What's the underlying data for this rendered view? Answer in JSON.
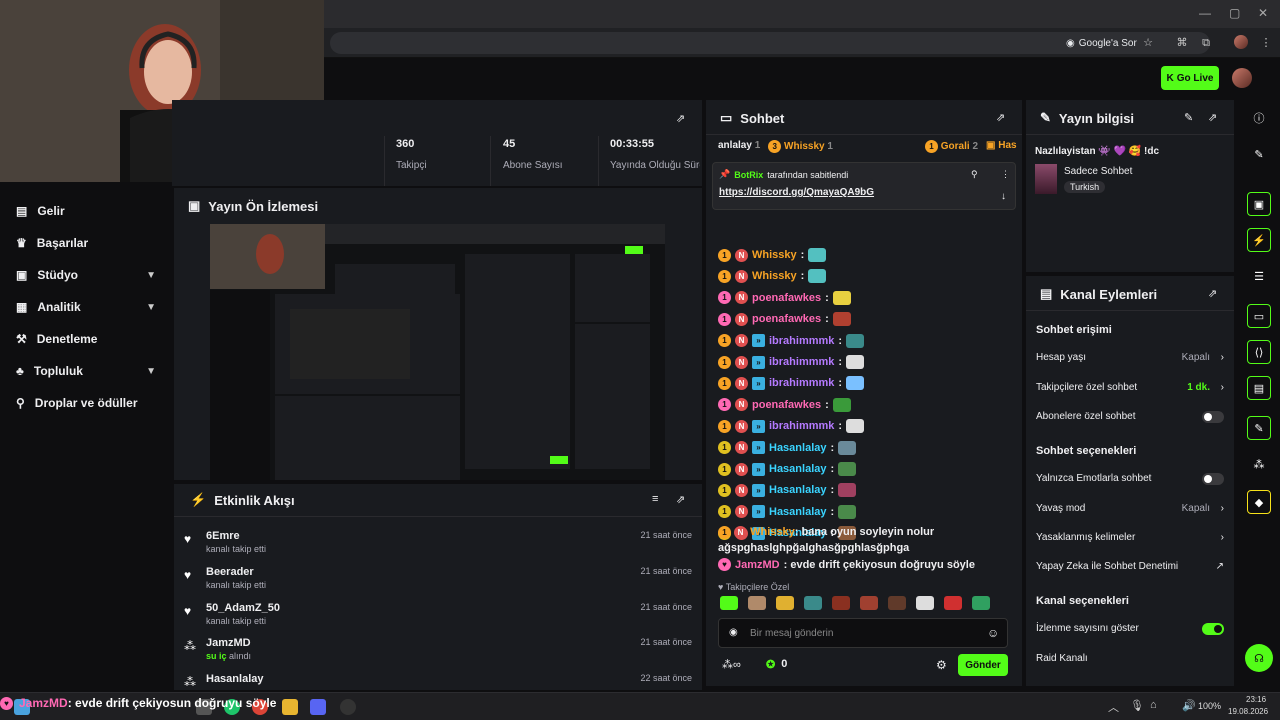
{
  "browser": {
    "google_ask": "Google'a Sor"
  },
  "topnav": {
    "go_live": "Go Live"
  },
  "sidebar": {
    "items": [
      {
        "label": "Gelir",
        "icon": "revenue-icon"
      },
      {
        "label": "Başarılar",
        "icon": "trophy-icon"
      },
      {
        "label": "Stüdyo",
        "icon": "studio-icon"
      },
      {
        "label": "Analitik",
        "icon": "analytics-icon"
      },
      {
        "label": "Denetleme",
        "icon": "moderation-icon"
      },
      {
        "label": "Topluluk",
        "icon": "community-icon"
      },
      {
        "label": "Droplar ve ödüller",
        "icon": "drops-icon"
      }
    ]
  },
  "stats": {
    "followers_value": "360",
    "followers_label": "Takipçi",
    "subs_value": "45",
    "subs_label": "Abone Sayısı",
    "uptime_value": "00:33:55",
    "uptime_label": "Yayında Olduğu Süre"
  },
  "preview": {
    "title": "Yayın Ön İzlemesi"
  },
  "events": {
    "title": "Etkinlik Akışı",
    "items": [
      {
        "name": "6Emre",
        "sub": "kanalı takip etti",
        "time": "21 saat önce",
        "icon": "heart-icon"
      },
      {
        "name": "Beerader",
        "sub": "kanalı takip etti",
        "time": "21 saat önce",
        "icon": "heart-icon"
      },
      {
        "name": "50_AdamZ_50",
        "sub": "kanalı takip etti",
        "time": "21 saat önce",
        "icon": "heart-icon"
      },
      {
        "name": "JamzMD",
        "sub_highlight": "su iç",
        "sub": "alındı",
        "time": "21 saat önce",
        "icon": "reward-icon"
      },
      {
        "name": "Hasanlalay",
        "sub": "",
        "time": "22 saat önce",
        "icon": "reward-icon"
      }
    ]
  },
  "chat": {
    "title": "Sohbet",
    "top_gifters": [
      {
        "name": "anlalay",
        "count": "1"
      },
      {
        "name": "Whissky",
        "count": "1",
        "rank": "3"
      },
      {
        "name": "Gorali",
        "count": "2",
        "rank": "1"
      },
      {
        "name": "Has"
      }
    ],
    "pinned_by": "BotRix",
    "pinned_suffix": "tarafından sabitlendi",
    "pinned_link": "https://discord.gg/QmayaQA9bG",
    "messages": [
      {
        "user": "Whissky",
        "color": "#f7a325",
        "text": ":"
      },
      {
        "user": "Whissky",
        "color": "#f7a325",
        "text": ":"
      },
      {
        "user": "poenafawkes",
        "color": "#ff69b4",
        "text": ":"
      },
      {
        "user": "poenafawkes",
        "color": "#ff69b4",
        "text": ":"
      },
      {
        "user": "ibrahimmmk",
        "color": "#b57aff",
        "text": ":"
      },
      {
        "user": "ibrahimmmk",
        "color": "#b57aff",
        "text": ":"
      },
      {
        "user": "ibrahimmmk",
        "color": "#b57aff",
        "text": ":"
      },
      {
        "user": "poenafawkes",
        "color": "#ff69b4",
        "text": ":"
      },
      {
        "user": "ibrahimmmk",
        "color": "#b57aff",
        "text": ":"
      },
      {
        "user": "Hasanlalay",
        "color": "#3ad4ff",
        "text": ":"
      },
      {
        "user": "Hasanlalay",
        "color": "#3ad4ff",
        "text": ":"
      },
      {
        "user": "Hasanlalay",
        "color": "#3ad4ff",
        "text": ":"
      },
      {
        "user": "Hasanlalay",
        "color": "#3ad4ff",
        "text": ":"
      },
      {
        "user": "Hasanlalay",
        "color": "#3ad4ff",
        "text": ":"
      }
    ],
    "long_msg_user": "Whissky",
    "long_msg_text1": ": bana oyun soyleyin nolur",
    "long_msg_text2": "ağspghaslghpğalghasğpghlasğphga",
    "last_msg_user": "JamzMD",
    "last_msg_text": ": evde drift çekiyosun doğruyu söyle",
    "followers_only": "Takipçilere Özel",
    "input_placeholder": "Bir mesaj gönderin",
    "points": "0",
    "send_label": "Gönder"
  },
  "stream_info": {
    "title": "Yayın bilgisi",
    "stream_title": "Nazlılayistan 👾 💜 🥰 !dc",
    "category": "Sadece Sohbet",
    "tag": "Turkish"
  },
  "channel_actions": {
    "title": "Kanal Eylemleri",
    "chat_access_title": "Sohbet erişimi",
    "account_age_label": "Hesap yaşı",
    "account_age_value": "Kapalı",
    "followers_chat_label": "Takipçilere özel sohbet",
    "followers_chat_value": "1 dk.",
    "subs_chat_label": "Abonelere özel sohbet",
    "chat_options_title": "Sohbet seçenekleri",
    "emote_only_label": "Yalnızca Emotlarla sohbet",
    "slow_mode_label": "Yavaş mod",
    "slow_mode_value": "Kapalı",
    "banned_words_label": "Yasaklanmış kelimeler",
    "ai_mod_label": "Yapay Zeka ile Sohbet Denetimi",
    "channel_options_title": "Kanal seçenekleri",
    "show_viewers_label": "İzlenme sayısını göster",
    "raid_label": "Raid Kanalı"
  },
  "taskbar": {
    "battery": "100%",
    "time": "23:16",
    "date": "19.08.2026"
  },
  "overlay": {
    "user": "JamzMD",
    "text": ": evde drift çekiyosun doğruyu söyle"
  },
  "colors": {
    "accent": "#53fc18",
    "panel": "#191b1f",
    "background": "#0e0e10"
  }
}
